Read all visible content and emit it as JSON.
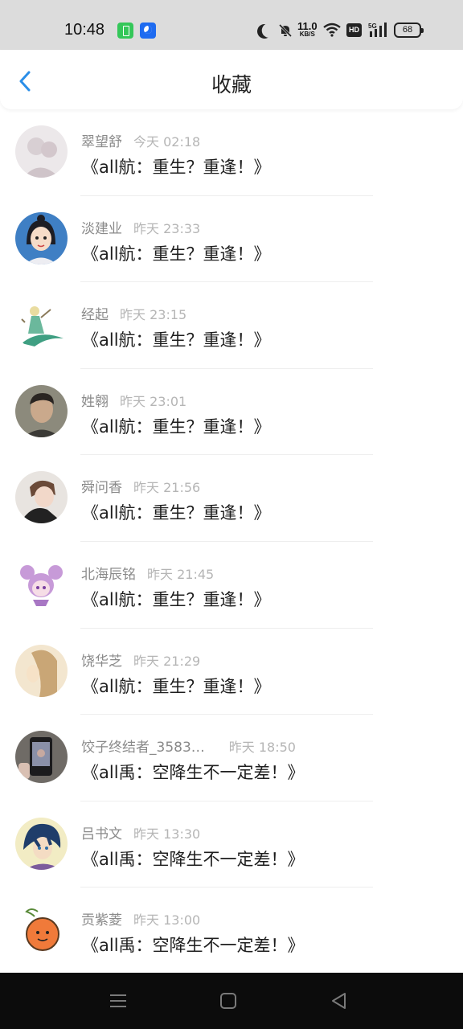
{
  "status_bar": {
    "time": "10:48",
    "net_speed_value": "11.0",
    "net_speed_unit": "KB/S",
    "hd_label": "HD",
    "network_label": "5G",
    "battery": "68"
  },
  "header": {
    "title": "收藏"
  },
  "favorites": [
    {
      "name": "翠望舒",
      "time": "今天 02:18",
      "title": "《all航：重生？重逢！》"
    },
    {
      "name": "淡建业",
      "time": "昨天 23:33",
      "title": "《all航：重生？重逢！》"
    },
    {
      "name": "经起",
      "time": "昨天 23:15",
      "title": "《all航：重生？重逢！》"
    },
    {
      "name": "姓翱",
      "time": "昨天 23:01",
      "title": "《all航：重生？重逢！》"
    },
    {
      "name": "舜问香",
      "time": "昨天 21:56",
      "title": "《all航：重生？重逢！》"
    },
    {
      "name": "北海辰铭",
      "time": "昨天 21:45",
      "title": "《all航：重生？重逢！》"
    },
    {
      "name": "饶华芝",
      "time": "昨天 21:29",
      "title": "《all航：重生？重逢！》"
    },
    {
      "name": "饺子终结者_3583…",
      "time": "昨天 18:50",
      "title": "《all禹：空降生不一定差！》"
    },
    {
      "name": "吕书文",
      "time": "昨天 13:30",
      "title": "《all禹：空降生不一定差！》"
    },
    {
      "name": "贡紫菱",
      "time": "昨天 13:00",
      "title": "《all禹：空降生不一定差！》"
    }
  ],
  "colors": {
    "accent": "#2a8ee8",
    "status_bar_bg": "#dcdcdc",
    "nav_bar_bg": "#0c0c0c"
  },
  "icons": {
    "back": "chevron-left-icon",
    "nav_menu": "menu-icon",
    "nav_home": "home-square-icon",
    "nav_back": "triangle-back-icon"
  }
}
